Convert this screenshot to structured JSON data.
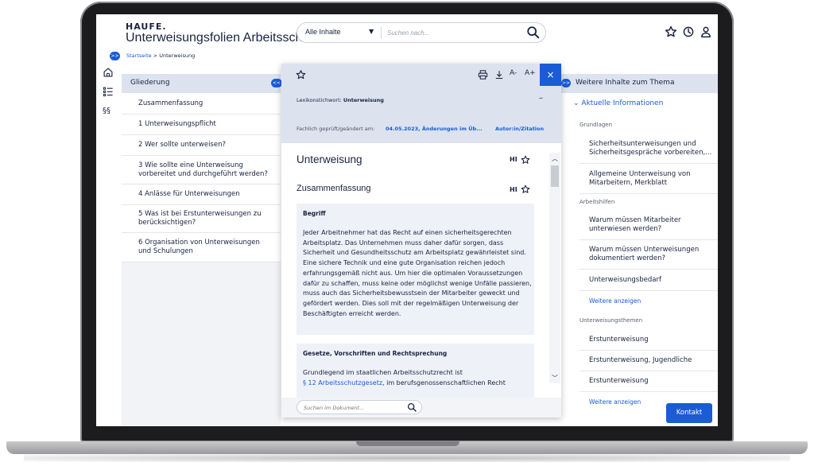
{
  "app": {
    "logo": "HAUFE.",
    "title": "Unterweisungsfolien Arbeitsschutz"
  },
  "breadcrumb": {
    "home": "Startseite",
    "separator": ">",
    "current": "Unterweisung"
  },
  "search": {
    "scope": "Alle Inhalte",
    "placeholder": "Suchen nach..."
  },
  "header_icons": [
    "star-icon",
    "history-icon",
    "user-icon"
  ],
  "left_rail": {
    "expand_label": ">>",
    "icons": [
      "home-icon",
      "list-icon",
      "paragraph-icon"
    ],
    "paragraph_label": "§§"
  },
  "outline": {
    "title": "Gliederung",
    "collapse_label": "<<",
    "items": [
      "Zusammenfassung",
      "1 Unterweisungspflicht",
      "2 Wer sollte unterweisen?",
      "3 Wie sollte eine Unterweisung vorbereitet und durchgeführt werden?",
      "4 Anlässe für Unterweisungen",
      "5 Was ist bei Erstunterweisungen zu berücksichtigen?",
      "6 Organisation von Unterweisungen und Schulungen"
    ]
  },
  "document": {
    "toolbar": {
      "star": "☆",
      "print": "print-icon",
      "download": "download-icon",
      "font_smaller": "A-",
      "font_larger": "A+",
      "close": "×"
    },
    "lexikon_label": "Lexikonstichwort:",
    "lexikon_value": "Unterweisung",
    "lexikon_toggle": "–",
    "checked_label": "Fachlich geprüft/geändert am:",
    "checked_value": "04.05.2023, Änderungen im Üb...",
    "author_link": "Autor:in/Zitation",
    "heading": "Unterweisung",
    "subheading": "Zusammenfassung",
    "hl_label": "HI",
    "box1_title": "Begriff",
    "box1_text": "Jeder Arbeitnehmer hat das Recht auf einen sicherheitsgerechten Arbeitsplatz. Das Unternehmen muss daher dafür sorgen, dass Sicherheit und Gesundheitsschutz am Arbeitsplatz gewährleistet sind. Eine sichere Technik und eine gute Organisation reichen jedoch erfahrungsgemäß nicht aus. Um hier die optimalen Voraussetzungen dafür zu schaffen, muss keine oder möglichst wenige Unfälle passieren, muss auch das Sicherheitsbewusstsein der Mitarbeiter geweckt und gefördert werden. Dies soll mit der regelmäßigen Unterweisung der Beschäftigten erreicht werden.",
    "box2_title": "Gesetze, Vorschriften und Rechtsprechung",
    "box2_text": "Grundlegend im staatlichen Arbeitsschutzrecht ist",
    "box2_link": "§ 12 Arbeitsschutzgesetz",
    "box2_text_after": ", im berufsgenossenschaftlichen Recht",
    "search_placeholder": "Suchen im Dokument..."
  },
  "related": {
    "expand_label": ">>",
    "title": "Weitere Inhalte zum Thema",
    "current_info": "Aktuelle Informationen",
    "sections": [
      {
        "category": "Grundlagen",
        "items": [
          "Sicherheitsunterweisungen und Sicherheitsgespräche vorbereiten,...",
          "Allgemeine Unterweisung von Mitarbeitern, Merkblatt"
        ]
      },
      {
        "category": "Arbeitshilfen",
        "items": [
          "Warum müssen Mitarbeiter unterwiesen werden?",
          "Warum müssen Unterweisungen dokumentiert werden?",
          "Unterweisungsbedarf"
        ],
        "more": "Weitere anzeigen"
      },
      {
        "category": "Unterweisungsthemen",
        "items": [
          "Erstunterweisung",
          "Erstunterweisung, Jugendliche",
          "Erstunterweisung"
        ],
        "more": "Weitere anzeigen"
      }
    ]
  },
  "contact_button": "Kontakt",
  "colors": {
    "accent": "#1a5bd6",
    "panel_header": "#dce3ef",
    "text": "#1a2340"
  }
}
